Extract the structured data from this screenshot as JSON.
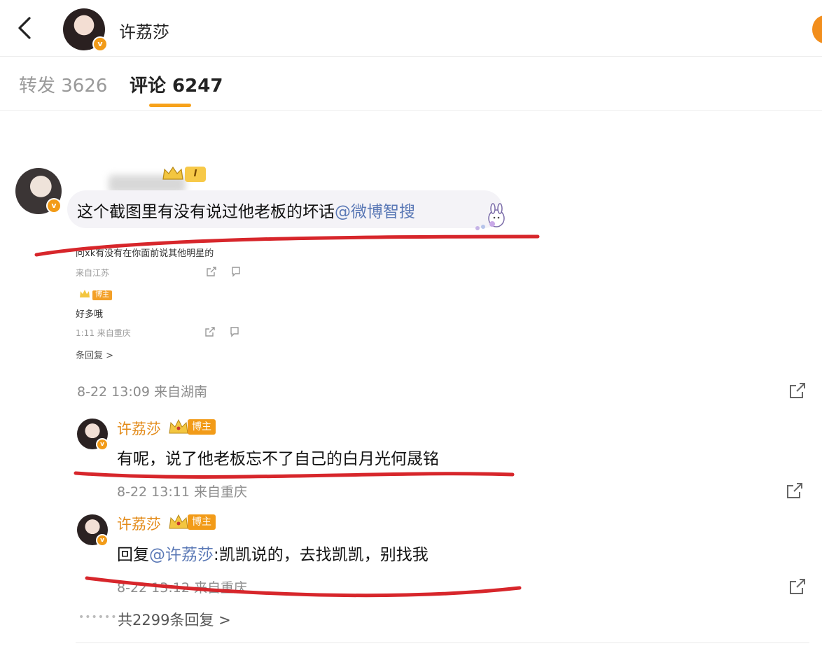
{
  "header": {
    "name": "许荔莎",
    "back_icon": "chevron-left-icon",
    "verified_icon": "v"
  },
  "tabs": [
    {
      "label": "转发 3626",
      "active": false
    },
    {
      "label": "评论 6247",
      "active": true
    }
  ],
  "comment": {
    "level": "I",
    "text": "这个截图里有没有说过他老板的坏话",
    "mention": "@微博智搜",
    "snippet": {
      "line1": "问xk有没有在你面前说其他明星的",
      "meta1": "来自江苏",
      "tag": "博主",
      "line2": "好多哦",
      "meta2": "1:11 来自重庆",
      "replies": "条回复 >"
    },
    "time": "8-22 13:09 来自湖南"
  },
  "replies": [
    {
      "name": "许荔莎",
      "tag": "博主",
      "text": "有呢，说了他老板忘不了自己的白月光何晟铭",
      "time": "8-22 13:11 来自重庆"
    },
    {
      "name": "许荔莎",
      "tag": "博主",
      "text_prefix": "回复",
      "mention": "@许荔莎",
      "text_suffix": ":凯凯说的，去找凯凯，别找我",
      "time": "8-22 13:12 来自重庆"
    }
  ],
  "more_replies": "共2299条回复 >",
  "colors": {
    "accent": "#f7a21b",
    "name": "#e38b1a",
    "mention": "#5b79b6",
    "annotation": "#d7262b"
  }
}
